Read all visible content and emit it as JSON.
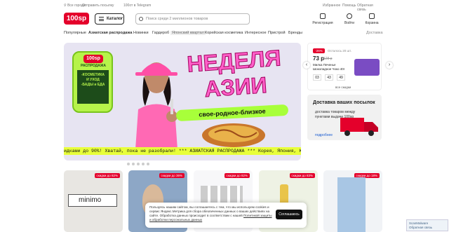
{
  "topbar": {
    "city": "Все города",
    "send": "Отправить посылку",
    "gift": "100от в Telegram",
    "fav": "Избранное",
    "help": "Помощь",
    "feedback": "Обратная связь"
  },
  "header": {
    "logo": "100sp",
    "catalog": "Каталог",
    "search_placeholder": "Поиск среди 2 миллионов товаров",
    "register": "Регистрация",
    "login": "Войти",
    "cart": "Корзина"
  },
  "nav": {
    "items": [
      "Популярные",
      "Азиатская распродажа",
      "Новинки",
      "Гардероб",
      "Японский квартал",
      "Корейская косметика",
      "Интересное",
      "Пристрой",
      "Бренды"
    ],
    "delivery": "Доставка"
  },
  "banner": {
    "logo": "100sp",
    "phone_title": "РАСПРОДАЖА",
    "phone_lines": "-КОСМЕТИКА\nИ УХОД\n-БАДЫ и ЕДА",
    "headline1": "НЕДЕЛЯ",
    "headline2": "АЗИИ",
    "slogan": "свое-родное-близкое",
    "cap": "100sp",
    "ticker": "идками до 90%! Хватай, пока не разобрали!   *** АЗИАТСКАЯ РАСПРОДАЖА *** Корея, Япония, Ки"
  },
  "side": {
    "discount": "-26%",
    "left": "Осталось 20 шт.",
    "price": "73 р",
    "old_price": "128 р",
    "name": "Милка Печенье Шоколадное Чокo 40г",
    "timer": [
      "03",
      "43",
      "49"
    ],
    "all": "все скидки"
  },
  "delivery": {
    "title": "Доставка ваших посылок",
    "text": "доставка товаров между пунктами выдачи 100sp",
    "more": "подробнее"
  },
  "products": [
    {
      "pct": "скидки до 82%",
      "label": "minimo"
    },
    {
      "pct": "скидки до 36%"
    },
    {
      "pct": "скидки до 82%"
    },
    {
      "pct": "скидки до 83%"
    },
    {
      "pct": "скидки до 18%"
    }
  ],
  "cookie": {
    "text": "Пользуясь нашим сайтом, вы соглашаетесь с тем, что мы используем cookies и сервис Яндекс.Метрика для сбора обезличенных данных о ваших действиях на сайте. Обработка данных происходит в соответствии с нашей",
    "link": "Политикой защиты и обработки персональных данных",
    "btn": "Соглашаюсь"
  },
  "scan": {
    "title": "ScanMalware",
    "sub": "Обратная связь"
  }
}
